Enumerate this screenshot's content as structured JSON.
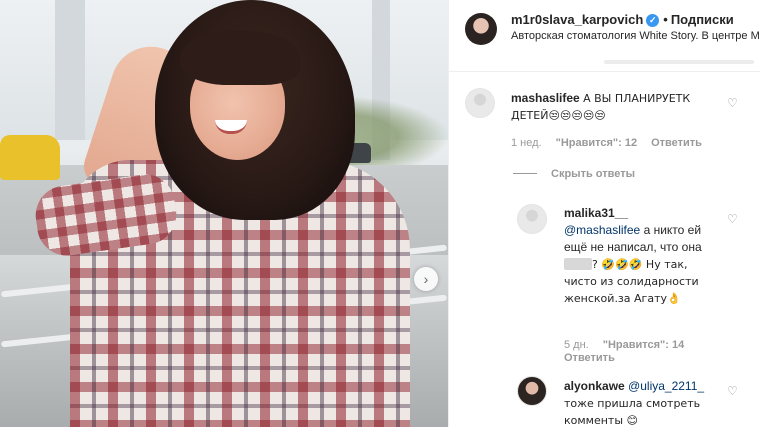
{
  "header": {
    "username": "m1r0slava_karpovich",
    "separator": "•",
    "follow_label": "Подписки",
    "subtitle": "Авторская стоматология White Story. В центре М"
  },
  "comments": [
    {
      "username": "mashaslifee",
      "text": "А ВЫ ПЛАНИРУЕТК ДЕТЕЙ😒😒😒😒😒",
      "time": "1 нед.",
      "likes": "\"Нравится\": 12",
      "reply_label": "Ответить",
      "hide_replies_label": "Скрыть ответы"
    },
    {
      "username": "malika31__",
      "mention": "@mashaslifee",
      "text_1": "а никто ей ещё не написал, что она",
      "text_2": "? 🤣🤣🤣 Ну так, чисто из солидарности женской.за Агату👌",
      "time": "5 дн.",
      "likes": "\"Нравится\": 14",
      "reply_label": "Ответить"
    },
    {
      "username": "alyonkawe",
      "mention": "@uliya_2211_",
      "text": "тоже пришла смотреть комменты 😊"
    }
  ],
  "icons": {
    "verified": "verified-badge-icon",
    "next": "chevron-right-icon",
    "heart": "heart-outline-icon"
  },
  "colors": {
    "accent": "#3897f0",
    "mention": "#003569",
    "meta": "#999999"
  }
}
